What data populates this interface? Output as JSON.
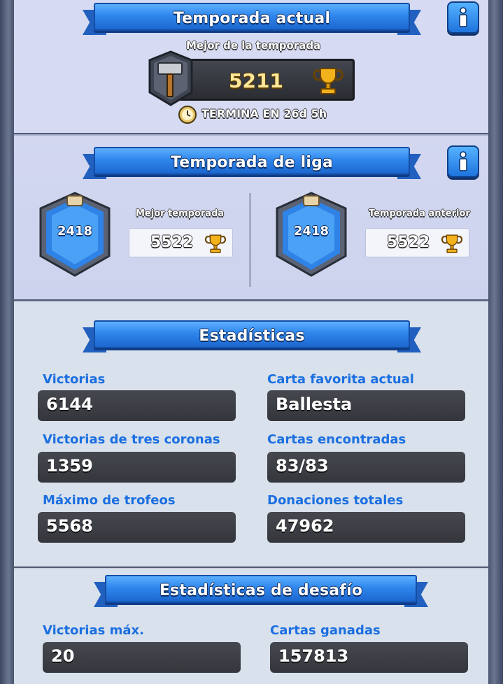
{
  "current_season": {
    "title": "Temporada actual",
    "best_label": "Mejor de la temporada",
    "best_value": "5211",
    "ends": "TERMINA EN 26d 5h"
  },
  "league_season": {
    "title": "Temporada de liga",
    "best": {
      "label": "Mejor temporada",
      "badge_value": "2418",
      "trophies": "5522"
    },
    "previous": {
      "label": "Temporada anterior",
      "badge_value": "2418",
      "trophies": "5522"
    }
  },
  "stats": {
    "title": "Estadísticas",
    "items": [
      {
        "label": "Victorias",
        "value": "6144"
      },
      {
        "label": "Carta favorita actual",
        "value": "Ballesta"
      },
      {
        "label": "Victorias de tres coronas",
        "value": "1359"
      },
      {
        "label": "Cartas encontradas",
        "value": "83/83"
      },
      {
        "label": "Máximo de trofeos",
        "value": "5568"
      },
      {
        "label": "Donaciones totales",
        "value": "47962"
      }
    ]
  },
  "challenge": {
    "title": "Estadísticas de desafío",
    "items": [
      {
        "label": "Victorias máx.",
        "value": "20"
      },
      {
        "label": "Cartas ganadas",
        "value": "157813"
      }
    ]
  },
  "colors": {
    "ribbon_blue": "#2f86ec",
    "label_blue": "#1b6fe0",
    "value_box": "#3d3f45",
    "trophy_gold": "#f2b21c"
  },
  "icons": {
    "info": "info-icon",
    "hammer": "hammer-icon",
    "trophy": "trophy-icon",
    "timer": "timer-icon",
    "elixir": "elixir-bottle-icon"
  }
}
